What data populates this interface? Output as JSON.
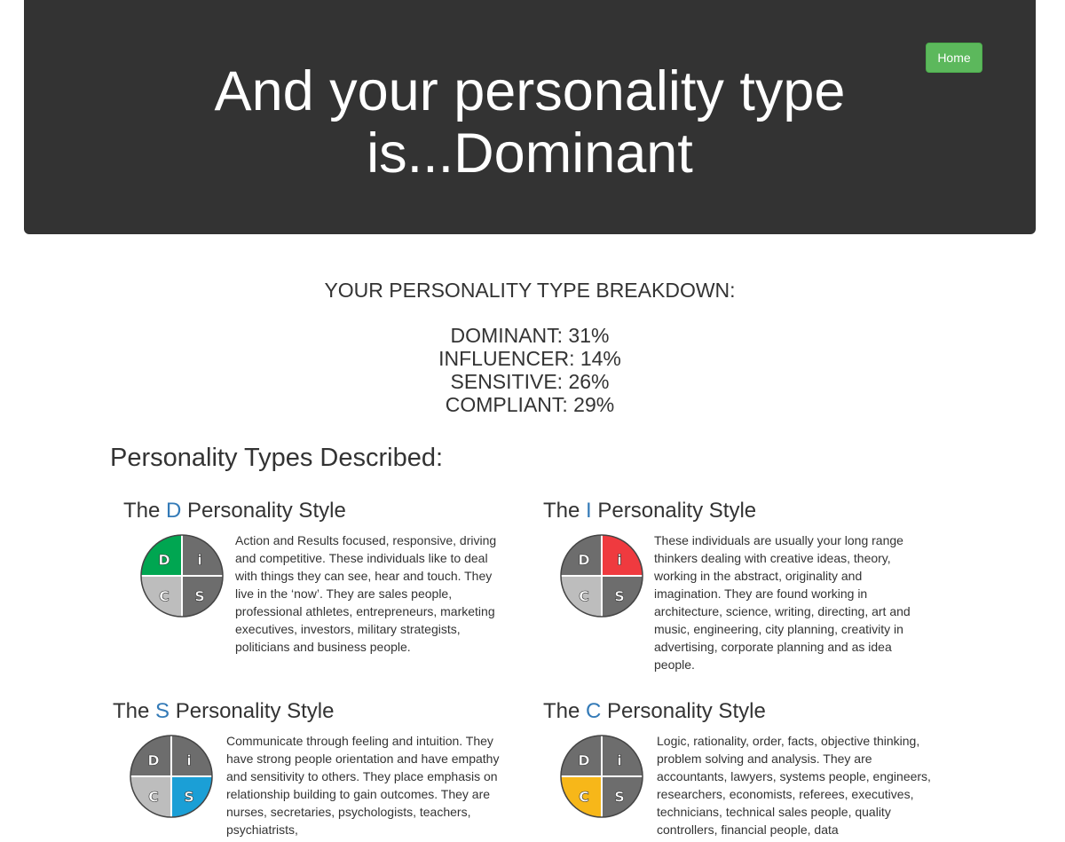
{
  "header": {
    "title_line1": "And your personality type",
    "title_line2": "is...Dominant",
    "home_label": "Home"
  },
  "breakdown": {
    "title": "YOUR PERSONALITY TYPE BREAKDOWN:",
    "scores": [
      {
        "label": "DOMINANT: 31%"
      },
      {
        "label": "INFLUENCER: 14%"
      },
      {
        "label": "SENSITIVE: 26%"
      },
      {
        "label": "COMPLIANT: 29%"
      }
    ]
  },
  "described": {
    "title": "Personality Types Described:",
    "cards": [
      {
        "title_prefix": "The ",
        "letter": "D",
        "title_suffix": " Personality Style",
        "highlight": "D",
        "highlight_color": "#00a651",
        "description": "Action and Results focused, responsive, driving and competitive. These individuals like to deal with things they can see, hear and touch. They live in the ‘now’. They are sales people, professional athletes, entrepreneurs, marketing executives, investors, military strategists, politicians and business people."
      },
      {
        "title_prefix": "The ",
        "letter": "I",
        "title_suffix": " Personality Style",
        "highlight": "i",
        "highlight_color": "#ef3a3f",
        "description": "These individuals are usually your long range thinkers dealing with creative ideas, theory, working in the abstract, originality and imagination. They are found working in architecture, science, writing, directing, art and music, engineering, city planning, creativity in advertising, corporate planning and as idea people."
      },
      {
        "title_prefix": "The ",
        "letter": "S",
        "title_suffix": " Personality Style",
        "highlight": "S",
        "highlight_color": "#1b9fd6",
        "description": "Communicate through feeling and intuition. They have strong people orientation and have empathy and sensitivity to others. They place emphasis on relationship building to gain outcomes. They are nurses, secretaries, psychologists, teachers, psychiatrists,"
      },
      {
        "title_prefix": "The ",
        "letter": "C",
        "title_suffix": " Personality Style",
        "highlight": "C",
        "highlight_color": "#f7b719",
        "description": "Logic, rationality, order, facts, objective thinking, problem solving and analysis. They are accountants, lawyers, systems people, engineers, researchers, economists, referees, executives, technicians, technical sales people, quality controllers, financial people, data"
      }
    ],
    "disc_letters": {
      "D": "D",
      "i": "i",
      "C": "C",
      "S": "S"
    },
    "disc_colors": {
      "dark": "#6d6d6d",
      "light": "#bdbdbd",
      "border": "#ffffff"
    }
  }
}
